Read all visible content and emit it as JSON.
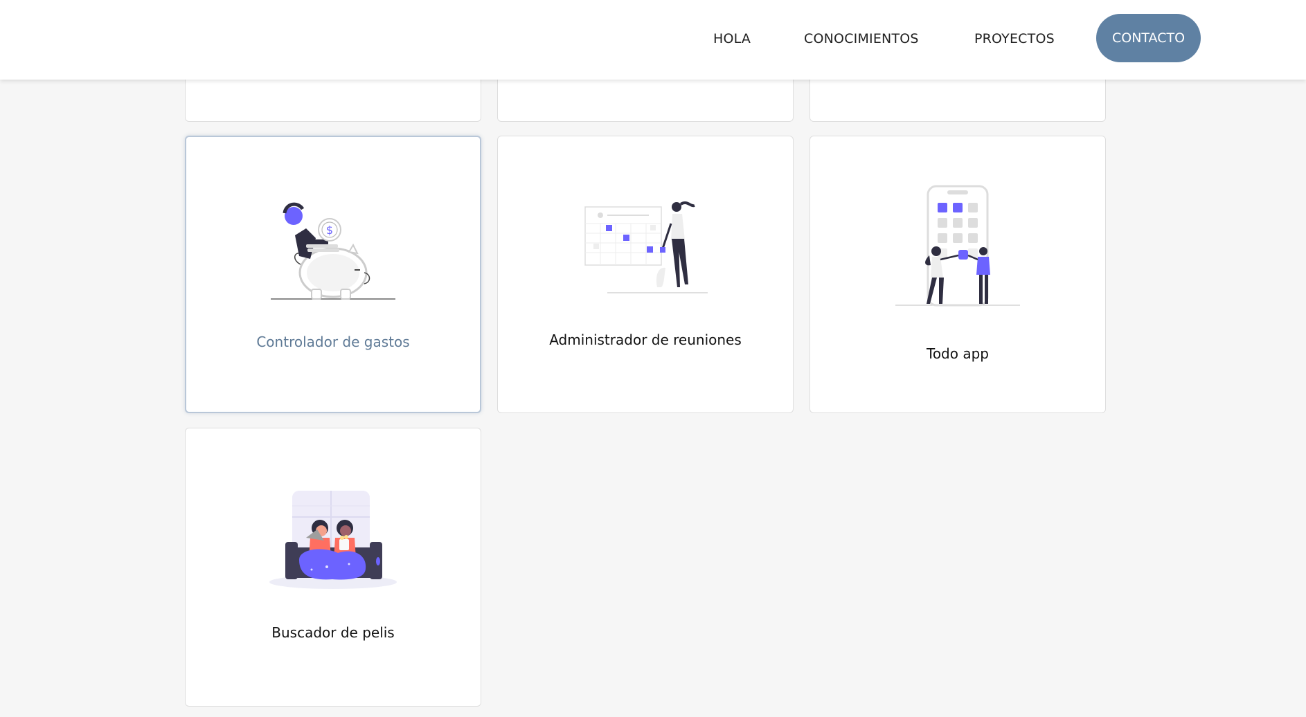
{
  "nav": {
    "items": [
      "HOLA",
      "CONOCIMIENTOS",
      "PROYECTOS"
    ],
    "cta": "CONTACTO"
  },
  "projects": [
    {
      "title": "Controlador de gastos",
      "illustration": "piggy-bank-illustration"
    },
    {
      "title": "Administrador de reuniones",
      "illustration": "calendar-woman-illustration"
    },
    {
      "title": "Todo app",
      "illustration": "mobile-app-illustration"
    },
    {
      "title": "Buscador de pelis",
      "illustration": "movie-couch-illustration"
    }
  ],
  "colors": {
    "accent": "#5f81a3",
    "illustration_purple": "#6c63ff",
    "background": "#f6f6f6"
  }
}
